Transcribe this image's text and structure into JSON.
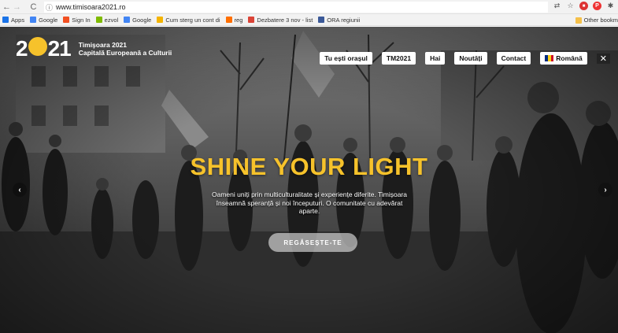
{
  "browser": {
    "url": "www.timisoara2021.ro",
    "bookmarks": [
      {
        "label": "Apps",
        "icon": "apps-grid-icon",
        "color": "#1a73e8"
      },
      {
        "label": "Google",
        "icon": "google-g-icon",
        "color": "#4285f4"
      },
      {
        "label": "Sign In",
        "icon": "microsoft-icon",
        "color": "#f25022"
      },
      {
        "label": "ezvol",
        "icon": "microsoft-icon",
        "color": "#7fba00"
      },
      {
        "label": "Google",
        "icon": "google-g-icon",
        "color": "#4285f4"
      },
      {
        "label": "Cum sterg un cont di",
        "icon": "chat-icon",
        "color": "#f4b400"
      },
      {
        "label": "reg",
        "icon": "bookmark-icon",
        "color": "#ff6f00"
      },
      {
        "label": "Dezbatere 3 nov - list",
        "icon": "gmail-icon",
        "color": "#db4437"
      },
      {
        "label": "ORA regiunii",
        "icon": "facebook-icon",
        "color": "#3b5998"
      }
    ],
    "other_bookmarks": "Other bookm"
  },
  "site": {
    "logo": {
      "num_left": "2",
      "num_right": "21",
      "line1": "Timişoara 2021",
      "line2": "Capitală Europeană a Culturii"
    },
    "nav": [
      "Tu ești orașul",
      "TM2021",
      "Hai",
      "Noutăți",
      "Contact"
    ],
    "language": "Română",
    "close": "✕",
    "headline": "SHINE YOUR LIGHT",
    "subline": "Oameni uniți prin multiculturalitate și experiențe diferite. Timișoara înseamnă speranță și noi începuturi. O comunitate cu adevărat aparte.",
    "cta": "REGĂSEȘTE-TE",
    "arrow_left": "‹",
    "arrow_right": "›"
  },
  "colors": {
    "accent": "#f6c22b",
    "flag": [
      "#002b7f",
      "#fcd116",
      "#ce1126"
    ]
  }
}
